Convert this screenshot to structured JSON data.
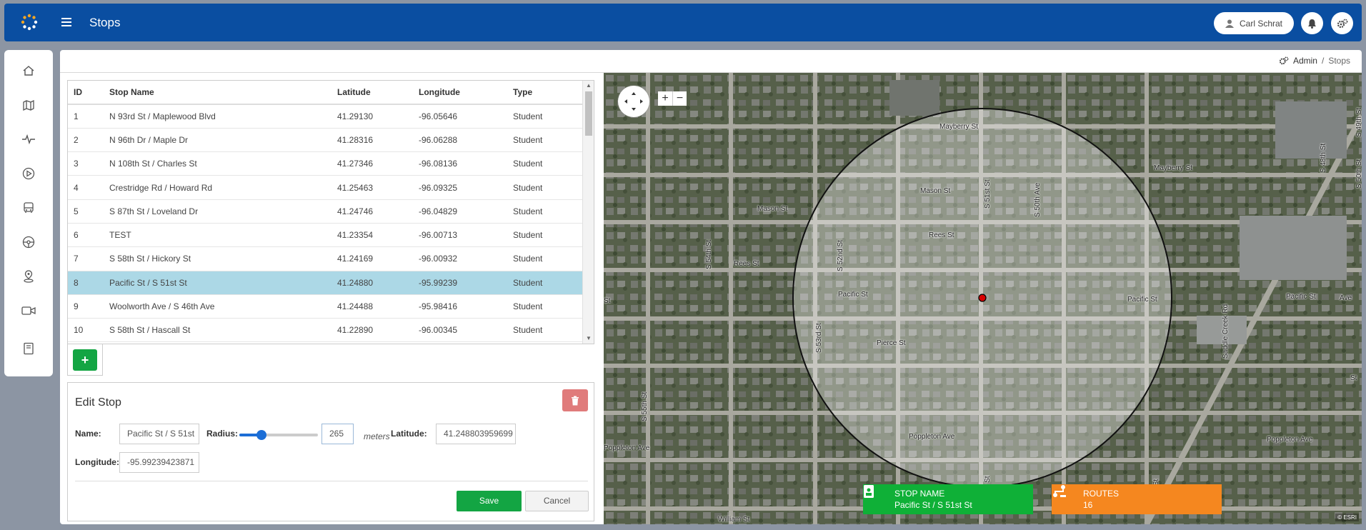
{
  "header": {
    "title": "Stops",
    "user_name": "Carl Schrat"
  },
  "breadcrumb": {
    "admin": "Admin",
    "current": "Stops"
  },
  "table": {
    "columns": [
      "ID",
      "Stop Name",
      "Latitude",
      "Longitude",
      "Type"
    ],
    "rows": [
      {
        "id": "1",
        "name": "N 93rd St / Maplewood Blvd",
        "lat": "41.29130",
        "lng": "-96.05646",
        "type": "Student"
      },
      {
        "id": "2",
        "name": "N 96th Dr / Maple Dr",
        "lat": "41.28316",
        "lng": "-96.06288",
        "type": "Student"
      },
      {
        "id": "3",
        "name": "N 108th St / Charles St",
        "lat": "41.27346",
        "lng": "-96.08136",
        "type": "Student"
      },
      {
        "id": "4",
        "name": "Crestridge Rd / Howard Rd",
        "lat": "41.25463",
        "lng": "-96.09325",
        "type": "Student"
      },
      {
        "id": "5",
        "name": "S 87th St / Loveland Dr",
        "lat": "41.24746",
        "lng": "-96.04829",
        "type": "Student"
      },
      {
        "id": "6",
        "name": "TEST",
        "lat": "41.23354",
        "lng": "-96.00713",
        "type": "Student"
      },
      {
        "id": "7",
        "name": "S 58th St / Hickory St",
        "lat": "41.24169",
        "lng": "-96.00932",
        "type": "Student"
      },
      {
        "id": "8",
        "name": "Pacific St / S 51st St",
        "lat": "41.24880",
        "lng": "-95.99239",
        "type": "Student"
      },
      {
        "id": "9",
        "name": "Woolworth Ave / S 46th Ave",
        "lat": "41.24488",
        "lng": "-95.98416",
        "type": "Student"
      },
      {
        "id": "10",
        "name": "S 58th St / Hascall St",
        "lat": "41.22890",
        "lng": "-96.00345",
        "type": "Student"
      }
    ],
    "selected_id": "8"
  },
  "edit": {
    "title": "Edit Stop",
    "name_label": "Name:",
    "name_value": "Pacific St / S 51st",
    "radius_label": "Radius:",
    "radius_value": "265",
    "radius_fraction": 0.28,
    "radius_unit": "meters",
    "latitude_label": "Latitude:",
    "latitude_value": "41.248803959699",
    "longitude_label": "Longitude:",
    "longitude_value": "-95.99239423871",
    "save_label": "Save",
    "cancel_label": "Cancel"
  },
  "map": {
    "streets_h": [
      "Mayberry St",
      "Mason St",
      "Rees St",
      "Pacific St",
      "Pierce St",
      "Poppleton Ave",
      "William St"
    ],
    "streets_v": [
      "S 51st St",
      "S 50th Ave",
      "S 52nd St",
      "S 53rd St",
      "S 54th St",
      "S 55th St",
      "S 49th St",
      "S 48th St",
      "S 50th St"
    ],
    "stop_card": {
      "label": "STOP NAME",
      "value": "Pacific St / S 51st St"
    },
    "routes_card": {
      "label": "ROUTES",
      "value": "16"
    },
    "attribution": "© ESRI",
    "extra_labels": [
      "Saddle Creek Rd",
      "St",
      "Ave"
    ]
  },
  "colors": {
    "header": "#0a4ea1",
    "selected_row": "#acd8e6",
    "save": "#13a543",
    "stop_card": "#0fb037",
    "routes_card": "#f5871f",
    "delete": "#e07b7b"
  }
}
